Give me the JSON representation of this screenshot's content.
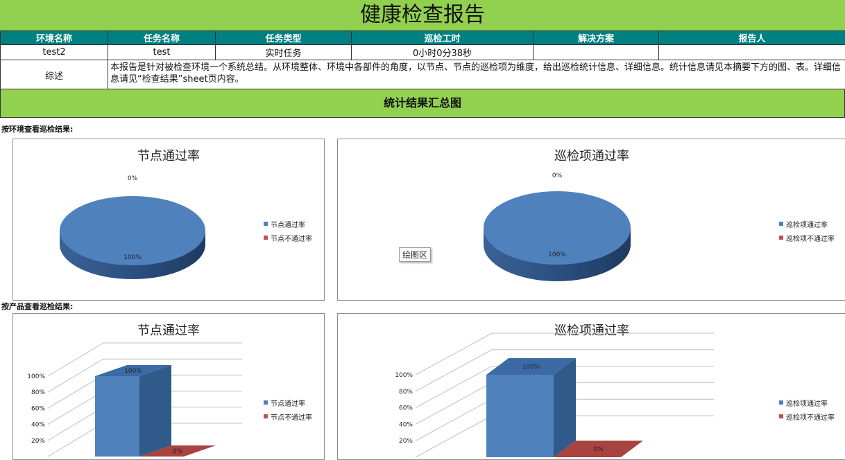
{
  "report_title": "健康检查报告",
  "headers": [
    "环境名称",
    "任务名称",
    "任务类型",
    "巡检工时",
    "解决方案",
    "报告人"
  ],
  "values": [
    "test2",
    "test",
    "实时任务",
    "0小时0分38秒",
    "",
    ""
  ],
  "summary_label": "综述",
  "summary_text": "本报告是针对被检查环境一个系统总结。从环境整体、环境中各部件的角度，以节点、节点的巡检项为维度，给出巡检统计信息、详细信息。统计信息请见本摘要下方的图、表。详细信息请见“检查结果”sheet页内容。",
  "stats_title": "统计结果汇总图",
  "section_env": "按环境查看巡检结果:",
  "section_product": "按产品查看巡检结果:",
  "tooltip": "绘图区",
  "colors": {
    "pass": "#4f81bd",
    "fail": "#c0504d",
    "header": "#008080",
    "banner": "#92d050"
  },
  "chart_data": [
    {
      "type": "pie",
      "title": "节点通过率",
      "categories": [
        "节点通过率",
        "节点不通过率"
      ],
      "values": [
        100,
        0
      ],
      "data_labels": [
        "100%",
        "0%"
      ],
      "legend_position": "right"
    },
    {
      "type": "pie",
      "title": "巡检项通过率",
      "categories": [
        "巡检项通过率",
        "巡检项不通过率"
      ],
      "values": [
        100,
        0
      ],
      "data_labels": [
        "100%",
        "0%"
      ],
      "legend_position": "right"
    },
    {
      "type": "bar",
      "title": "节点通过率",
      "categories": [
        "节点通过率",
        "节点不通过率"
      ],
      "values": [
        100,
        0
      ],
      "data_labels": [
        "100%",
        "0%"
      ],
      "y_ticks": [
        "20%",
        "40%",
        "60%",
        "80%",
        "100%"
      ],
      "grid": true,
      "legend_position": "right"
    },
    {
      "type": "bar",
      "title": "巡检项通过率",
      "categories": [
        "巡检项通过率",
        "巡检项不通过率"
      ],
      "values": [
        100,
        0
      ],
      "data_labels": [
        "100%",
        "0%"
      ],
      "y_ticks": [
        "20%",
        "40%",
        "60%",
        "80%",
        "100%"
      ],
      "grid": true,
      "legend_position": "right"
    }
  ]
}
